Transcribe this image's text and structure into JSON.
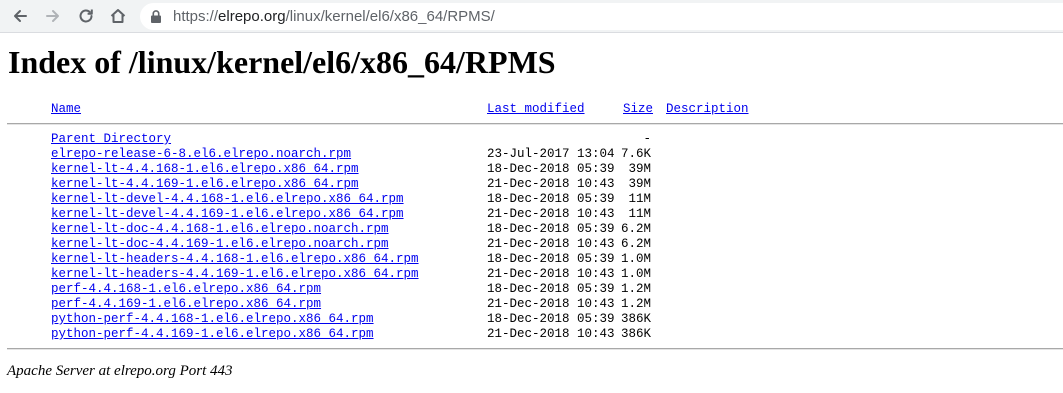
{
  "browser": {
    "back_icon": "arrow-left-icon",
    "forward_icon": "arrow-right-icon",
    "reload_icon": "reload-icon",
    "home_icon": "home-icon",
    "lock_icon": "lock-icon",
    "url_proto": "https://",
    "url_host": "elrepo.org",
    "url_path": "/linux/kernel/el6/x86_64/RPMS/"
  },
  "page": {
    "title": "Index of /linux/kernel/el6/x86_64/RPMS",
    "headers": {
      "name": "Name",
      "last_modified": "Last modified",
      "size": "Size",
      "description": "Description"
    },
    "parent": {
      "name": "Parent Directory",
      "size": "-"
    },
    "rows": [
      {
        "name": "elrepo-release-6-8.el6.elrepo.noarch.rpm",
        "date": "23-Jul-2017 13:04",
        "size": "7.6K"
      },
      {
        "name": "kernel-lt-4.4.168-1.el6.elrepo.x86_64.rpm",
        "date": "18-Dec-2018 05:39",
        "size": "39M"
      },
      {
        "name": "kernel-lt-4.4.169-1.el6.elrepo.x86_64.rpm",
        "date": "21-Dec-2018 10:43",
        "size": "39M"
      },
      {
        "name": "kernel-lt-devel-4.4.168-1.el6.elrepo.x86_64.rpm",
        "date": "18-Dec-2018 05:39",
        "size": "11M"
      },
      {
        "name": "kernel-lt-devel-4.4.169-1.el6.elrepo.x86_64.rpm",
        "date": "21-Dec-2018 10:43",
        "size": "11M"
      },
      {
        "name": "kernel-lt-doc-4.4.168-1.el6.elrepo.noarch.rpm",
        "date": "18-Dec-2018 05:39",
        "size": "6.2M"
      },
      {
        "name": "kernel-lt-doc-4.4.169-1.el6.elrepo.noarch.rpm",
        "date": "21-Dec-2018 10:43",
        "size": "6.2M"
      },
      {
        "name": "kernel-lt-headers-4.4.168-1.el6.elrepo.x86_64.rpm",
        "date": "18-Dec-2018 05:39",
        "size": "1.0M"
      },
      {
        "name": "kernel-lt-headers-4.4.169-1.el6.elrepo.x86_64.rpm",
        "date": "21-Dec-2018 10:43",
        "size": "1.0M"
      },
      {
        "name": "perf-4.4.168-1.el6.elrepo.x86_64.rpm",
        "date": "18-Dec-2018 05:39",
        "size": "1.2M"
      },
      {
        "name": "perf-4.4.169-1.el6.elrepo.x86_64.rpm",
        "date": "21-Dec-2018 10:43",
        "size": "1.2M"
      },
      {
        "name": "python-perf-4.4.168-1.el6.elrepo.x86_64.rpm",
        "date": "18-Dec-2018 05:39",
        "size": "386K"
      },
      {
        "name": "python-perf-4.4.169-1.el6.elrepo.x86_64.rpm",
        "date": "21-Dec-2018 10:43",
        "size": "386K"
      }
    ],
    "footer": "Apache Server at elrepo.org Port 443"
  }
}
